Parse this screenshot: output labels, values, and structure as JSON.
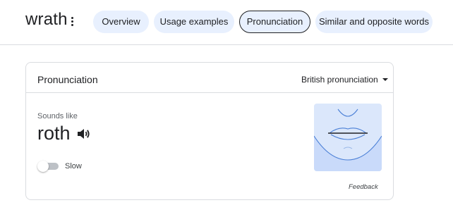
{
  "header": {
    "word": "wrath",
    "more_icon": "more-vert-icon",
    "tabs": [
      {
        "label": "Overview",
        "active": false
      },
      {
        "label": "Usage examples",
        "active": false
      },
      {
        "label": "Pronunciation",
        "active": true
      },
      {
        "label": "Similar and opposite words",
        "active": false
      }
    ]
  },
  "card": {
    "title": "Pronunciation",
    "accent_select": {
      "selected": "British pronunciation",
      "icon": "dropdown-arrow-icon"
    },
    "sounds_like_label": "Sounds like",
    "phonetic": "roth",
    "speaker_icon": "speaker-icon",
    "slow_toggle": {
      "label": "Slow",
      "on": false
    },
    "illustration_icon": "mouth-illustration-icon",
    "feedback_label": "Feedback"
  },
  "colors": {
    "chip_bg": "#e8f0fe",
    "divider": "#dadce0",
    "illustration_bg": "#dbe7fb",
    "illustration_line": "#4a7fd6"
  }
}
